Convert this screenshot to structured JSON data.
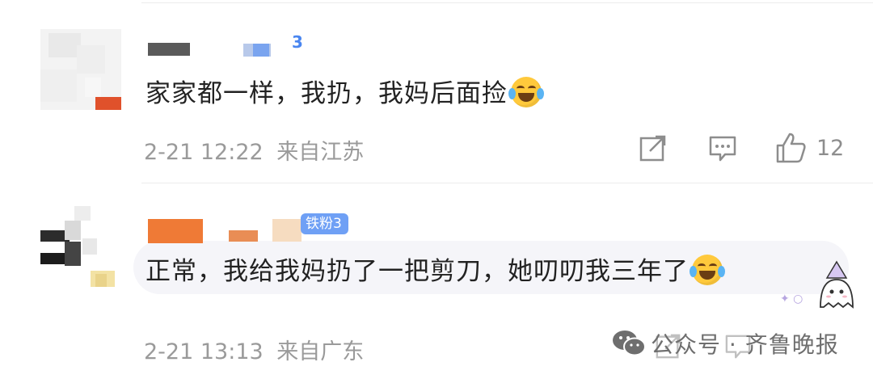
{
  "comments": [
    {
      "text": "家家都一样，我扔，我妈后面捡",
      "timestamp": "2-21 12:22",
      "location": "来自江苏",
      "like_count": "12",
      "badge_number": "3",
      "emoji": "laughing-crying-emoji"
    },
    {
      "text": "正常，我给我妈扔了一把剪刀，她叨叨我三年了",
      "timestamp": "2-21 13:13",
      "location": "来自广东",
      "badge_label": "铁粉3",
      "emoji": "laughing-crying-emoji",
      "sticker": "ghost-wizard-sticker"
    }
  ],
  "watermark": {
    "text": "公众号 · 齐鲁晚报",
    "icon": "wechat-icon"
  },
  "icons": {
    "share": "share-icon",
    "comment": "comment-icon",
    "like": "thumbs-up-icon"
  },
  "colors": {
    "badge_bg": "#6fa0f5",
    "meta_text": "#9a9a9a",
    "emoji": "#ffc93c"
  }
}
